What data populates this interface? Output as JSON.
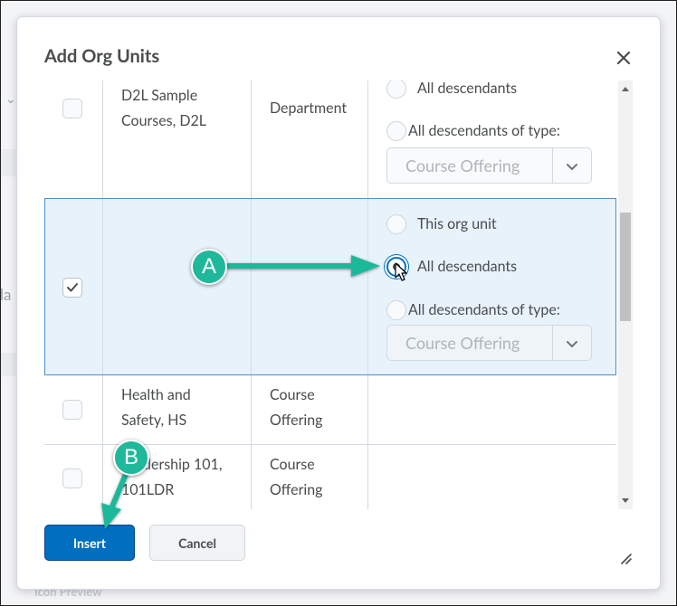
{
  "background": {
    "side_text": "la",
    "footer_text": "Icon Preview"
  },
  "dialog": {
    "title": "Add Org Units",
    "close_icon": "close-icon",
    "insert_label": "Insert",
    "cancel_label": "Cancel"
  },
  "rows": [
    {
      "name": "D2L Sample Courses, D2L",
      "name_line1": "D2L Sample",
      "name_line2": "Courses, D2L",
      "type_line1": "Department",
      "type_line2": "",
      "checked": false,
      "options": {
        "all_descendants": "All descendants",
        "all_descendants_of_type": "All descendants of type:",
        "type_select_value": "Course Offering"
      }
    },
    {
      "name_line1": "",
      "name_line2": "",
      "type_line1": "",
      "checked": true,
      "options": {
        "this_org_unit": "This org unit",
        "all_descendants": "All descendants",
        "all_descendants_of_type": "All descendants of type:",
        "type_select_value": "Course Offering",
        "selected": "All descendants"
      }
    },
    {
      "name_line1": "Health and",
      "name_line2": "Safety, HS",
      "type_line1": "Course",
      "type_line2": "Offering",
      "checked": false
    },
    {
      "name_line1": "Leadership 101,",
      "name_line2": "101LDR",
      "type_line1": "Course",
      "type_line2": "Offering",
      "checked": false
    }
  ],
  "callouts": {
    "a": "A",
    "b": "B"
  },
  "colors": {
    "primary": "#006fbf",
    "selected_row_bg": "#e8f2fb",
    "callout": "#1fb89a"
  }
}
